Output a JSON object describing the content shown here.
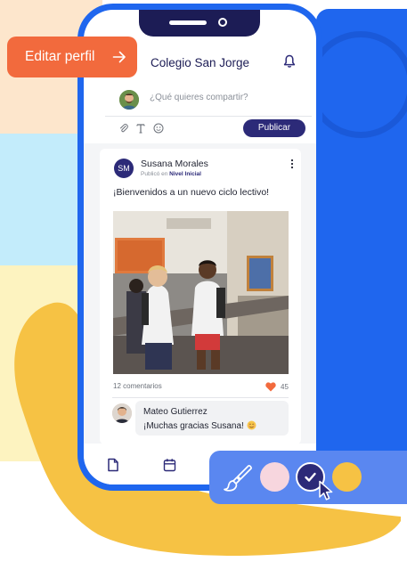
{
  "app": {
    "title": "Colegio San Jorge"
  },
  "floating": {
    "edit_profile_label": "Editar perfil"
  },
  "composer": {
    "placeholder": "¿Qué quieres compartir?",
    "publish_label": "Publicar",
    "tools": [
      "paperclip-icon",
      "text-format-icon",
      "emoji-icon"
    ]
  },
  "post": {
    "author_initials": "SM",
    "author_name": "Susana Morales",
    "published_prefix": "Publicó en",
    "published_group": "Nivel Inicial",
    "text": "¡Bienvenidos a un nuevo ciclo lectivo!",
    "comments_count": "12 comentarios",
    "likes_count": "45"
  },
  "comment": {
    "author": "Mateo Gutierrez",
    "text": "¡Muchas gracias Susana!"
  },
  "bottom_nav": {
    "items": [
      "document-icon",
      "calendar-icon"
    ]
  },
  "theme_picker": {
    "swatches": [
      "#f7d6de",
      "#2c2a78",
      "#f6c244"
    ],
    "selected": "#2c2a78"
  },
  "colors": {
    "primary": "#2c2a78",
    "accent_orange": "#f26a3d",
    "phone_frame": "#1f66ee",
    "like_heart": "#f26a3d"
  }
}
